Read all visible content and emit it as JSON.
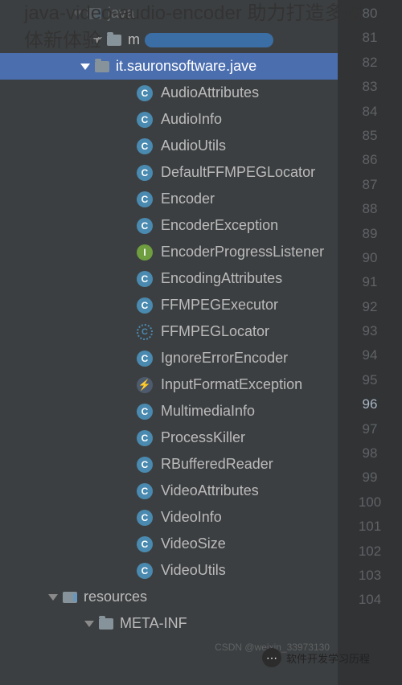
{
  "overlay": {
    "title": "java-video-audio-encoder 助力打造多媒体新体验"
  },
  "tree": {
    "java_folder": "java",
    "com_prefix": "m",
    "package_name": "it.sauronsoftware.jave",
    "classes": [
      {
        "name": "AudioAttributes",
        "icon": "class"
      },
      {
        "name": "AudioInfo",
        "icon": "class"
      },
      {
        "name": "AudioUtils",
        "icon": "class"
      },
      {
        "name": "DefaultFFMPEGLocator",
        "icon": "class"
      },
      {
        "name": "Encoder",
        "icon": "class"
      },
      {
        "name": "EncoderException",
        "icon": "class"
      },
      {
        "name": "EncoderProgressListener",
        "icon": "interface"
      },
      {
        "name": "EncodingAttributes",
        "icon": "class"
      },
      {
        "name": "FFMPEGExecutor",
        "icon": "class"
      },
      {
        "name": "FFMPEGLocator",
        "icon": "abstract"
      },
      {
        "name": "IgnoreErrorEncoder",
        "icon": "class"
      },
      {
        "name": "InputFormatException",
        "icon": "exception"
      },
      {
        "name": "MultimediaInfo",
        "icon": "class"
      },
      {
        "name": "ProcessKiller",
        "icon": "class"
      },
      {
        "name": "RBufferedReader",
        "icon": "class"
      },
      {
        "name": "VideoAttributes",
        "icon": "class"
      },
      {
        "name": "VideoInfo",
        "icon": "class"
      },
      {
        "name": "VideoSize",
        "icon": "class"
      },
      {
        "name": "VideoUtils",
        "icon": "class"
      }
    ],
    "resources_folder": "resources",
    "meta_inf_folder": "META-INF"
  },
  "gutter": {
    "lines": [
      80,
      81,
      82,
      83,
      84,
      85,
      86,
      87,
      88,
      89,
      90,
      91,
      92,
      93,
      94,
      95,
      96,
      97,
      98,
      99,
      100,
      101,
      102,
      103,
      104
    ],
    "current": 96
  },
  "icon_glyphs": {
    "class": "C",
    "interface": "I",
    "abstract": "C",
    "exception": "⚡"
  },
  "watermark": "CSDN @weixin_33973130",
  "wechat_label": "软件开发学习历程"
}
